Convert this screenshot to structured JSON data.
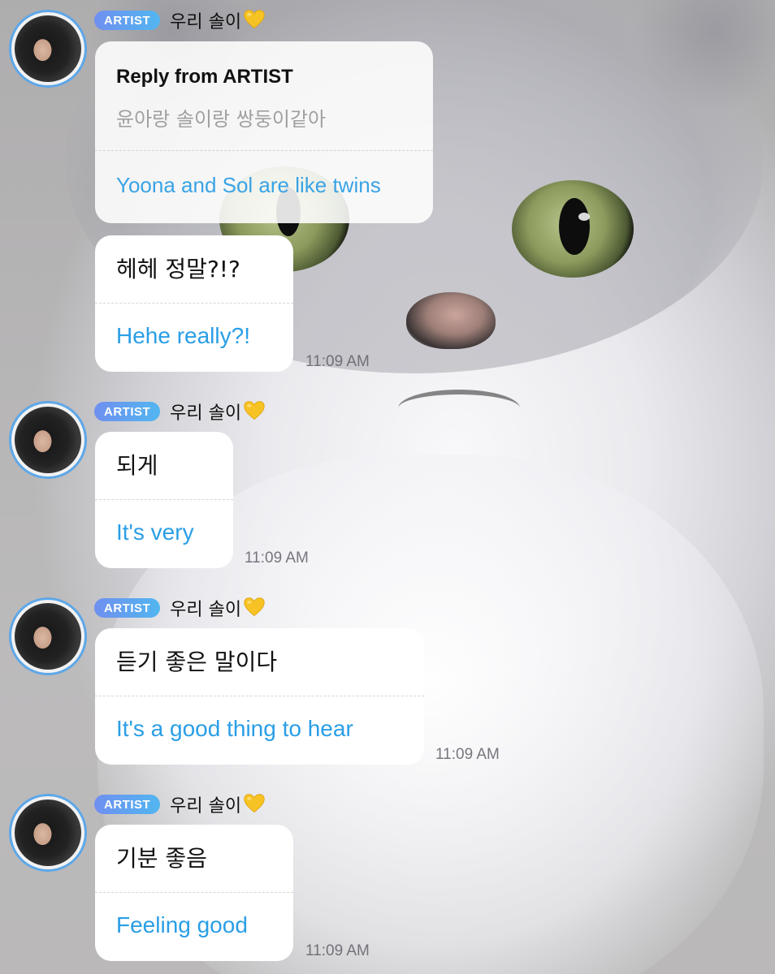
{
  "colors": {
    "badge_gradient_start": "#6f8ff0",
    "badge_gradient_end": "#52b6f0",
    "translated_text": "#2a9ee6",
    "avatar_ring": "#5ea7e8"
  },
  "background": {
    "image": "cat-photo"
  },
  "reply_context": {
    "header": {
      "badge": "ARTIST",
      "name": "우리 솔이",
      "emoji_icon": "yellow-heart-icon"
    },
    "title": "Reply from ARTIST",
    "original": "윤아랑 솔이랑 쌍둥이같아",
    "translated": "Yoona and Sol are like twins"
  },
  "messages": [
    {
      "original": "헤헤 정말?!?",
      "translated": "Hehe really?!",
      "time": "11:09 AM"
    },
    {
      "header": {
        "badge": "ARTIST",
        "name": "우리 솔이",
        "emoji_icon": "yellow-heart-icon"
      },
      "original": "되게",
      "translated": "It's very",
      "time": "11:09 AM"
    },
    {
      "header": {
        "badge": "ARTIST",
        "name": "우리 솔이",
        "emoji_icon": "yellow-heart-icon"
      },
      "original": "듣기 좋은 말이다",
      "translated": "It's a good thing to hear",
      "time": "11:09 AM"
    },
    {
      "header": {
        "badge": "ARTIST",
        "name": "우리 솔이",
        "emoji_icon": "yellow-heart-icon"
      },
      "original": "기분 좋음",
      "translated": "Feeling good",
      "time": "11:09 AM"
    }
  ]
}
